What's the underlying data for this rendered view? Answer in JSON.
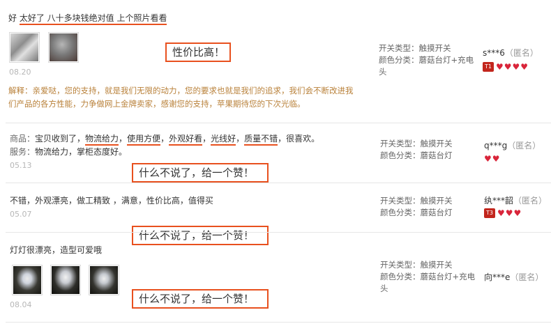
{
  "reviews": [
    {
      "text_parts": [
        "好 ",
        "太好了 八十多块钱绝对值 上个照片看看"
      ],
      "date": "08.20",
      "callout": "性价比高！",
      "reply": "解释：亲爱哒，您的支持，就是我们无限的动力，您的要求也就是我们的追求，我们会不断改进我们产品的各方性能，力争做网上金牌卖家，感谢您的支持，苹果期待您的下次光临。",
      "switch_label": "开关类型：",
      "switch_value": "触摸开关",
      "color_label": "颜色分类：",
      "color_value": "蘑菇台灯+充电头",
      "user": "s***6",
      "anon": "（匿名）",
      "badge": "T1",
      "hearts": 4
    },
    {
      "prefix": "商品：",
      "text_start": "宝贝收到了，",
      "tags": [
        "物流给力",
        "使用方便",
        "外观好看",
        "光线好",
        "质量不错"
      ],
      "text_end": "，很喜欢。",
      "service_prefix": "服务：",
      "service_text": "物流给力，掌柜态度好。",
      "date": "05.13",
      "callout": "什么不说了，给一个赞！",
      "switch_label": "开关类型：",
      "switch_value": "触摸开关",
      "color_label": "颜色分类：",
      "color_value": "蘑菇台灯",
      "user": "q***g",
      "anon": "（匿名）",
      "hearts": 2
    },
    {
      "text": "不错，外观漂亮，做工精致 ，满意，性价比高，值得买",
      "date": "05.07",
      "callout": "什么不说了，给一个赞！",
      "switch_label": "开关类型：",
      "switch_value": "触摸开关",
      "color_label": "颜色分类：",
      "color_value": "蘑菇台灯",
      "user": "纨***韶",
      "anon": "（匿名）",
      "badge": "T3",
      "hearts": 3
    },
    {
      "text": "灯灯很漂亮，造型可爱哦",
      "date": "08.04",
      "callout": "什么不说了，给一个赞！",
      "switch_label": "开关类型：",
      "switch_value": "触摸开关",
      "color_label": "颜色分类：",
      "color_value": "蘑菇台灯+充电头",
      "user": "向***e",
      "anon": "（匿名）"
    }
  ],
  "colors": {
    "accent": "#e8501e",
    "reply": "#b9813a",
    "heart": "#d9253a",
    "badge": "#c2261d"
  }
}
